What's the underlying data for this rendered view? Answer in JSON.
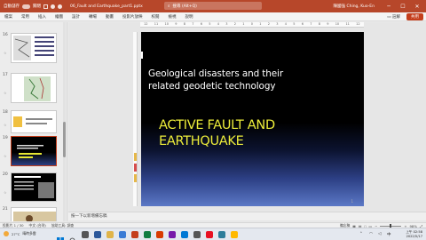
{
  "titlebar": {
    "autosave_label": "自動儲存",
    "autosave_state": "關閉",
    "file_name": "06_Fault and Earthquake_part1.pptx",
    "search_placeholder": "搜尋 (Alt+Q)",
    "user_name": "陳國強 Ching, Kuo-En",
    "minimize": "─",
    "maximize": "☐",
    "close": "✕"
  },
  "menu": {
    "items": [
      "檔案",
      "常用",
      "插入",
      "繪圖",
      "設計",
      "轉場",
      "動畫",
      "投影片放映",
      "校閱",
      "檢視",
      "說明"
    ],
    "comment_label": "註解",
    "share_label": "共用"
  },
  "thumbnails": [
    {
      "num": "16"
    },
    {
      "num": "17"
    },
    {
      "num": "18"
    },
    {
      "num": "19"
    },
    {
      "num": "20"
    },
    {
      "num": "21"
    }
  ],
  "ruler": {
    "ticks": [
      "12",
      "11",
      "10",
      "9",
      "8",
      "7",
      "6",
      "5",
      "4",
      "3",
      "2",
      "1",
      "0",
      "1",
      "2",
      "3",
      "4",
      "5",
      "6",
      "7",
      "8",
      "9",
      "10",
      "11",
      "12"
    ]
  },
  "slide": {
    "title_line1": "Geological disasters and their",
    "title_line2": "related geodetic technology",
    "subtitle_line1": "ACTIVE FAULT AND",
    "subtitle_line2": "EARTHQUAKE",
    "page_number": "1"
  },
  "notes": {
    "placeholder": "按一下以新增備忘稿"
  },
  "status": {
    "slide_counter": "投影片 1 / 30",
    "language": "中文 (台灣)",
    "accessibility": "協助工具: 調查",
    "notes_btn": "備忘稿",
    "zoom": "98%"
  },
  "taskbar": {
    "weather_temp": "27°C",
    "weather_desc": "晴時多雲",
    "time": "上午 02:58",
    "date": "2022/5/17",
    "lang": "中",
    "colors": [
      "#2b579a",
      "#e0b44a",
      "#3a7bd5",
      "#c43e1c",
      "#107c41",
      "#d83b01",
      "#7719aa",
      "#0078d4",
      "#555555",
      "#e81123",
      "#2d7d9a",
      "#ffb900"
    ]
  }
}
